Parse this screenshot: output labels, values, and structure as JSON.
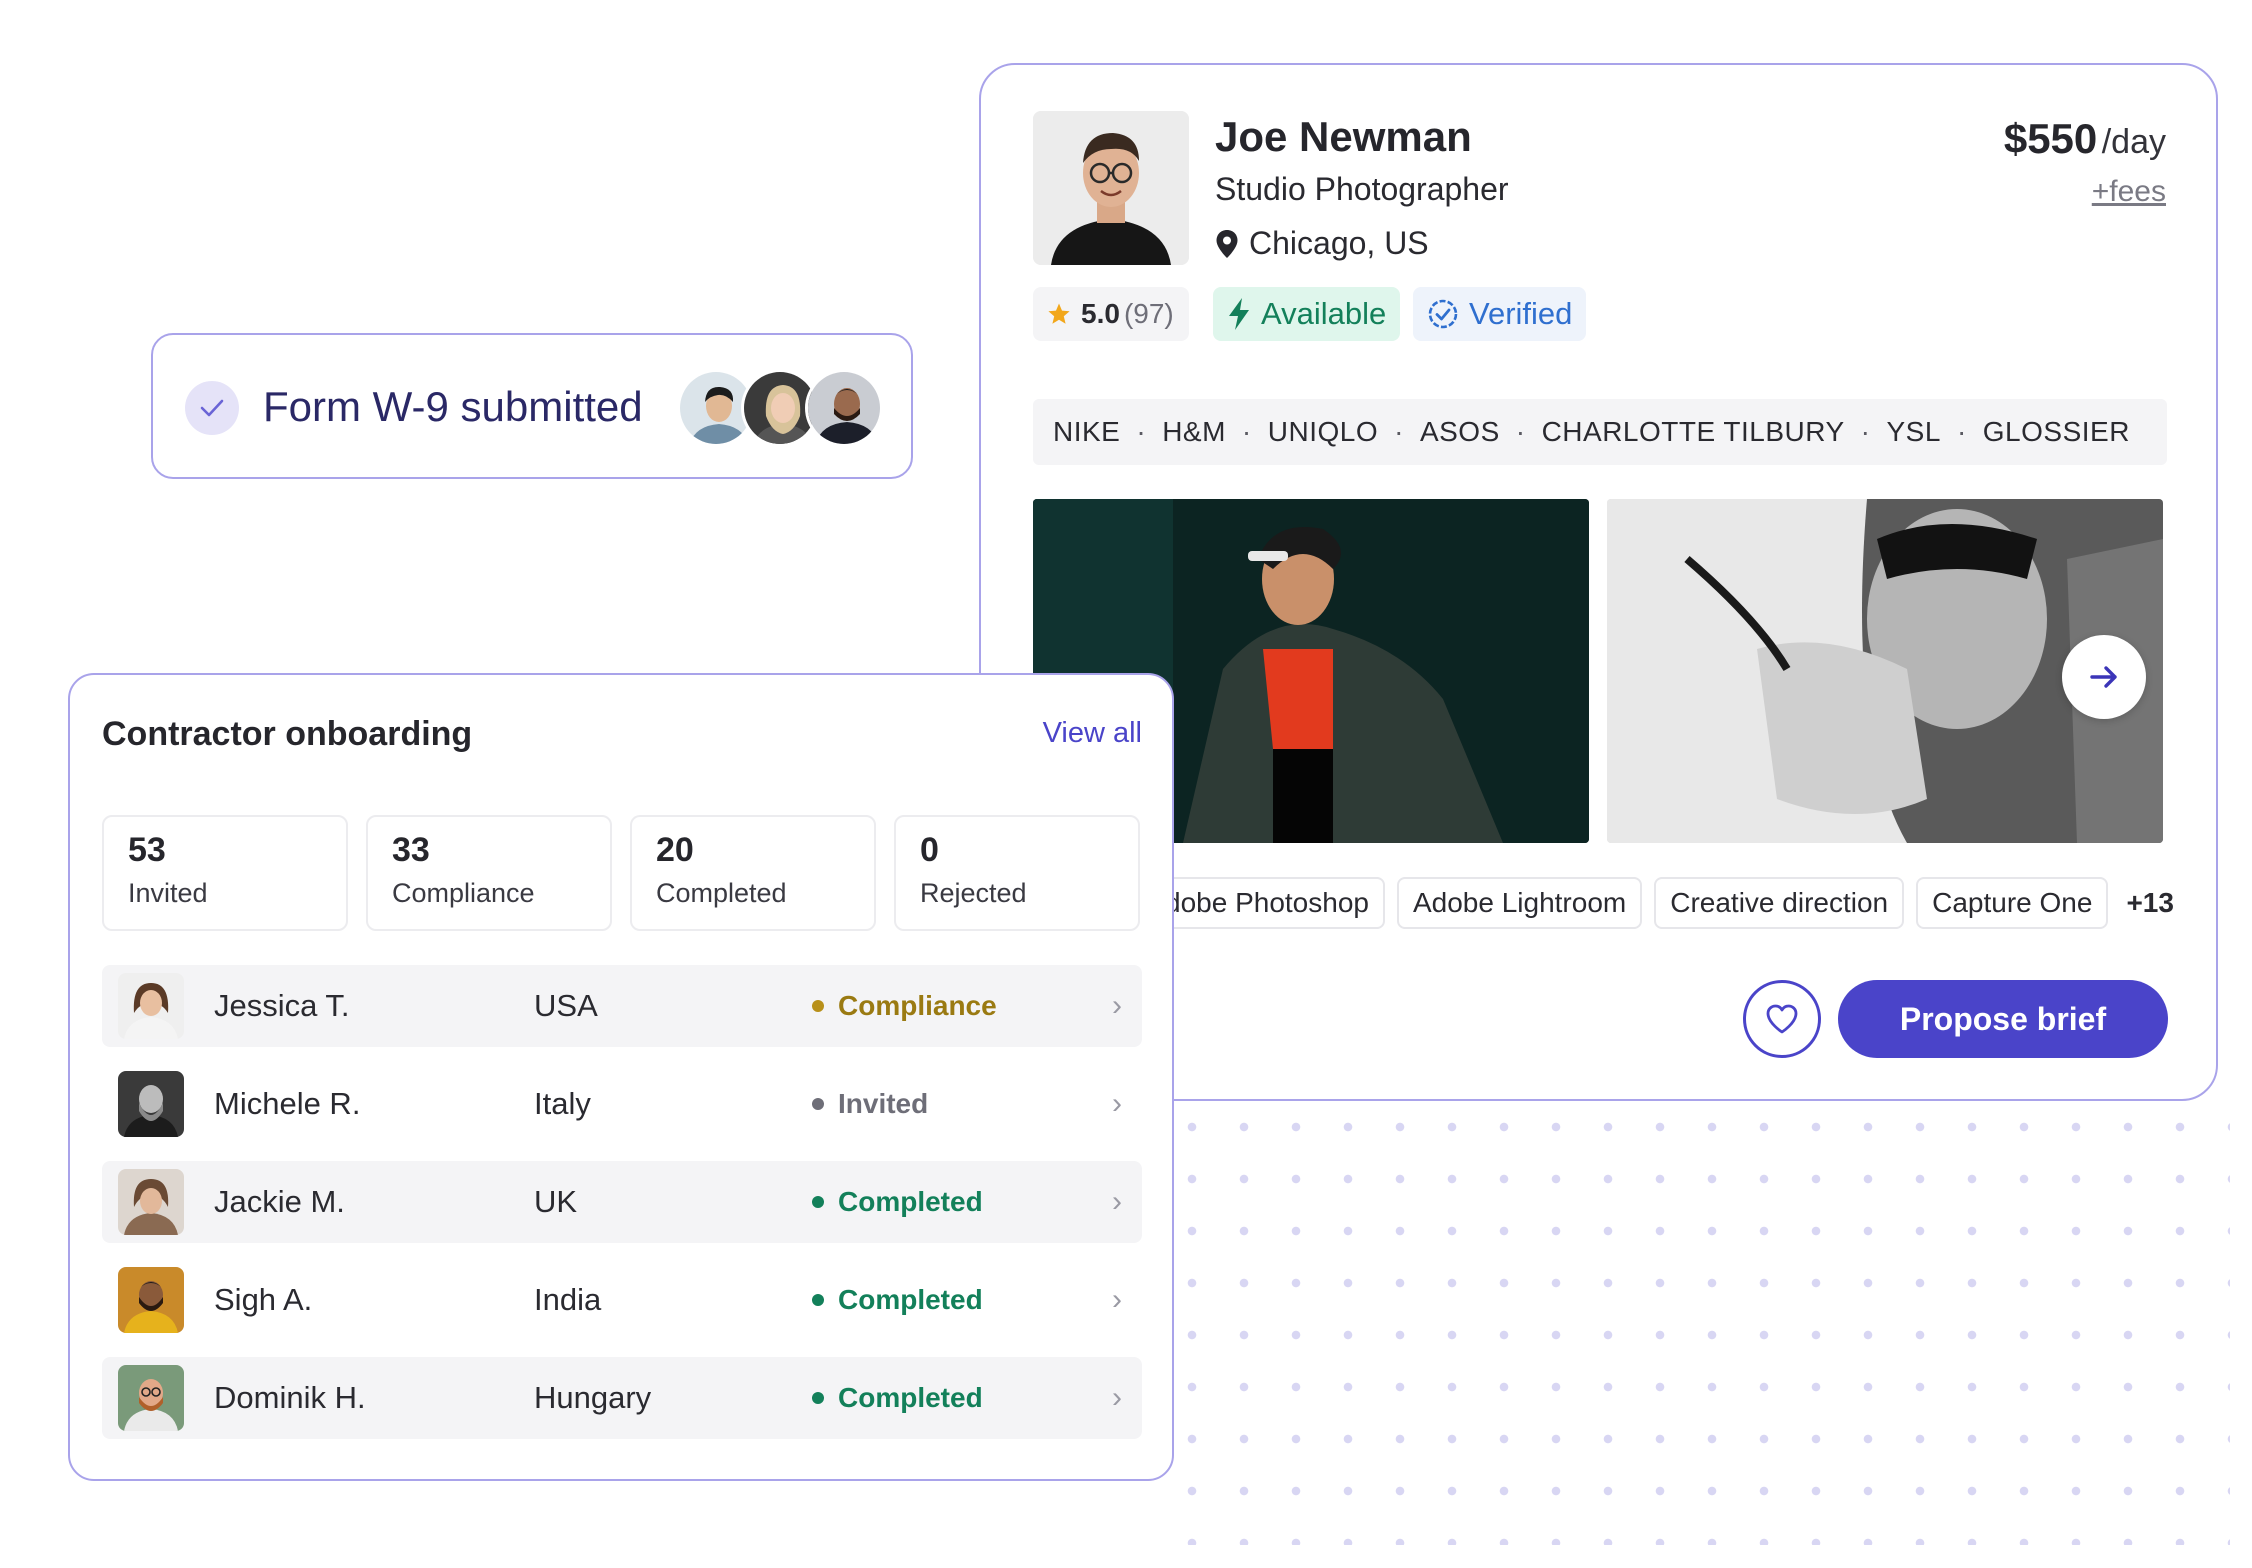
{
  "profile": {
    "name": "Joe Newman",
    "role": "Studio Photographer",
    "location": "Chicago, US",
    "price": "$550",
    "price_unit": "/day",
    "fees": "+fees",
    "rating": "5.0",
    "rating_count": "(97)",
    "available_label": "Available",
    "verified_label": "Verified",
    "brands": [
      "NIKE",
      "H&M",
      "UNIQLO",
      "ASOS",
      "CHARLOTTE TILBURY",
      "YSL",
      "GLOSSIER"
    ],
    "brand_separator": "·",
    "skills": [
      "dobe Photoshop",
      "Adobe Lightroom",
      "Creative direction",
      "Capture One"
    ],
    "skills_more": "+13",
    "propose_label": "Propose brief",
    "colors": {
      "accent": "#4a44c9",
      "available": "#13805a",
      "verified": "#2f6fcf",
      "border": "#a9a3ea"
    }
  },
  "toast": {
    "label": "Form W-9 submitted"
  },
  "onboarding": {
    "title": "Contractor onboarding",
    "view_all": "View all",
    "stats": [
      {
        "num": "53",
        "label": "Invited"
      },
      {
        "num": "33",
        "label": "Compliance"
      },
      {
        "num": "20",
        "label": "Completed"
      },
      {
        "num": "0",
        "label": "Rejected"
      }
    ],
    "rows": [
      {
        "name": "Jessica T.",
        "country": "USA",
        "status": "Compliance",
        "status_color": "#9a7a12",
        "dot_color": "#b8901a"
      },
      {
        "name": "Michele R.",
        "country": "Italy",
        "status": "Invited",
        "status_color": "#6e6e78",
        "dot_color": "#6e6e78"
      },
      {
        "name": "Jackie M.",
        "country": "UK",
        "status": "Completed",
        "status_color": "#13805a",
        "dot_color": "#13805a"
      },
      {
        "name": "Sigh A.",
        "country": "India",
        "status": "Completed",
        "status_color": "#13805a",
        "dot_color": "#13805a"
      },
      {
        "name": "Dominik H.",
        "country": "Hungary",
        "status": "Completed",
        "status_color": "#13805a",
        "dot_color": "#13805a"
      }
    ]
  }
}
